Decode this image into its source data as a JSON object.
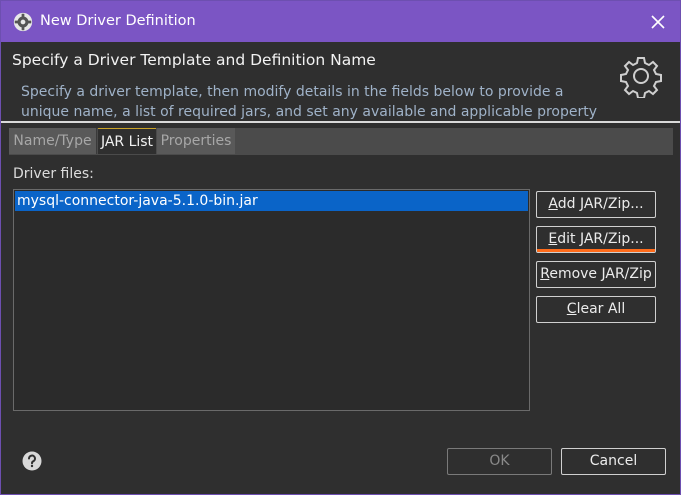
{
  "window": {
    "title": "New Driver Definition",
    "app_icon": "gear-icon",
    "close_icon": "close-icon"
  },
  "header": {
    "heading": "Specify a Driver Template and Definition Name",
    "description": "Specify a driver template, then modify details in the fields below to provide a unique name, a list of required jars, and set any available and applicable property",
    "banner_icon": "gear-icon"
  },
  "tabs": [
    {
      "label": "Name/Type",
      "active": false
    },
    {
      "label": "JAR List",
      "active": true
    },
    {
      "label": "Properties",
      "active": false
    }
  ],
  "jar_list": {
    "label": "Driver files:",
    "files": [
      "mysql-connector-java-5.1.0-bin.jar"
    ],
    "selected_index": 0
  },
  "buttons": {
    "add_mnemonic": "A",
    "add_rest": "dd JAR/Zip...",
    "edit_mnemonic": "E",
    "edit_rest": "dit JAR/Zip...",
    "remove_mnemonic": "R",
    "remove_rest": "emove JAR/Zip",
    "clear_mnemonic": "C",
    "clear_rest": "lear All",
    "ok": "OK",
    "cancel": "Cancel"
  },
  "footer": {
    "help_icon": "help-icon"
  },
  "colors": {
    "titlebar": "#7b55c4",
    "selection": "#0a64c8",
    "focus": "#ff6b1a",
    "description_text": "#9fb2c8"
  }
}
